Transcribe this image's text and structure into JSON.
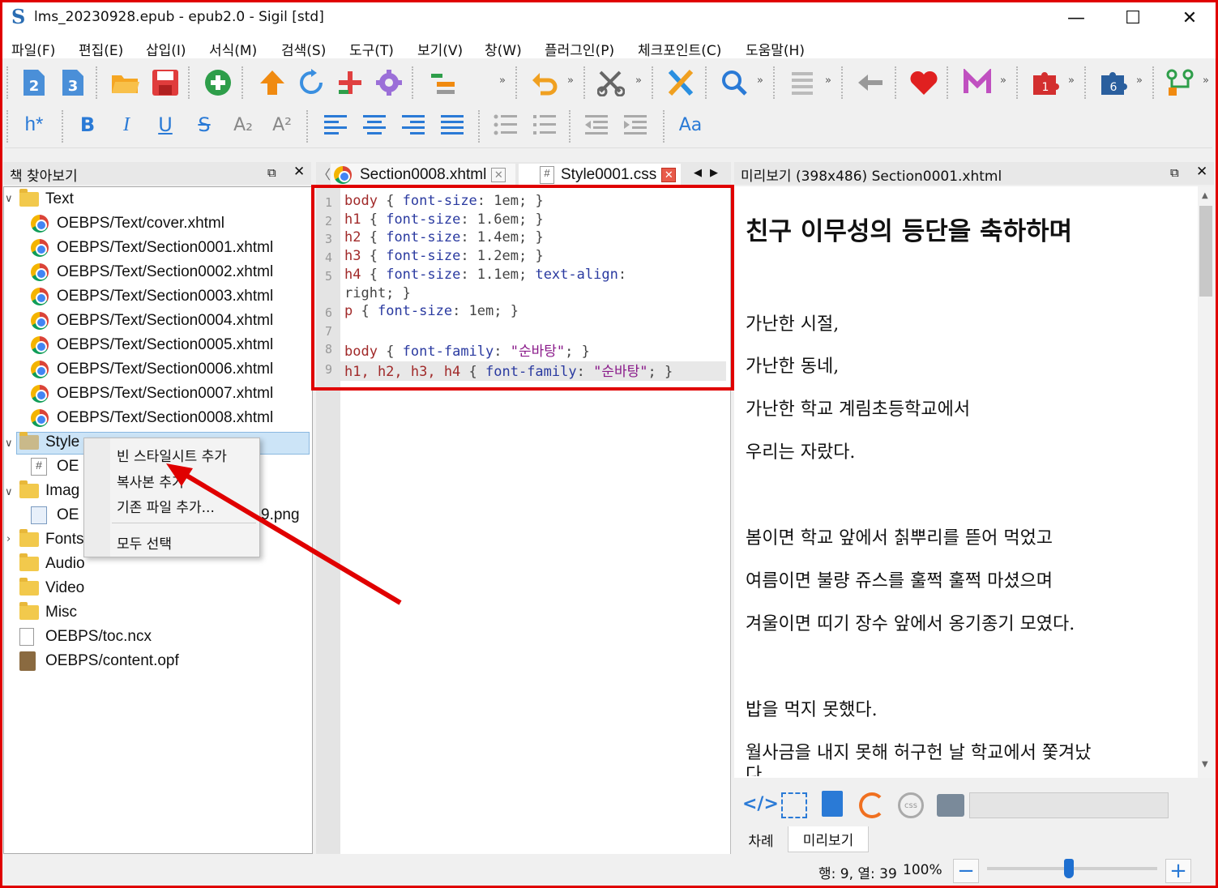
{
  "window": {
    "title": "lms_20230928.epub - epub2.0 - Sigil [std]",
    "logo_text": "S",
    "minimize": "—",
    "maximize": "☐",
    "close": "✕"
  },
  "menu": [
    "파일(F)",
    "편집(E)",
    "삽입(I)",
    "서식(M)",
    "검색(S)",
    "도구(T)",
    "보기(V)",
    "창(W)",
    "플러그인(P)",
    "체크포인트(C)",
    "도움말(H)"
  ],
  "toolbar1": {
    "icons": [
      "epub2-icon",
      "epub3-icon",
      "open-folder-icon",
      "save-icon",
      "add-icon",
      "up-arrow-icon",
      "refresh-icon",
      "add-existing-icon",
      "settings-icon",
      "insert-icon",
      "undo-icon",
      "cut-icon",
      "validate-icon",
      "search-icon",
      "list-icon",
      "back-icon",
      "heart-icon",
      "mail-icon",
      "plugin1-icon",
      "plugin6-icon",
      "plugin-branch-icon"
    ],
    "plugin_badges": [
      "1",
      "6"
    ],
    "epub_labels": [
      "2",
      "3"
    ]
  },
  "toolbar2": {
    "heading_label": "h*",
    "bold": "B",
    "italic": "I",
    "underline": "U",
    "strike": "S",
    "subscript": "A₂",
    "superscript": "A²",
    "case_label": "Aa"
  },
  "book_browser": {
    "title": "책 찾아보기",
    "rows": [
      {
        "label": "Text",
        "kind": "folder"
      },
      {
        "label": "OEBPS/Text/cover.xhtml",
        "kind": "chrome"
      },
      {
        "label": "OEBPS/Text/Section0001.xhtml",
        "kind": "chrome"
      },
      {
        "label": "OEBPS/Text/Section0002.xhtml",
        "kind": "chrome"
      },
      {
        "label": "OEBPS/Text/Section0003.xhtml",
        "kind": "chrome"
      },
      {
        "label": "OEBPS/Text/Section0004.xhtml",
        "kind": "chrome"
      },
      {
        "label": "OEBPS/Text/Section0005.xhtml",
        "kind": "chrome"
      },
      {
        "label": "OEBPS/Text/Section0006.xhtml",
        "kind": "chrome"
      },
      {
        "label": "OEBPS/Text/Section0007.xhtml",
        "kind": "chrome"
      },
      {
        "label": "OEBPS/Text/Section0008.xhtml",
        "kind": "chrome"
      },
      {
        "label": "Style",
        "kind": "folder-selected"
      },
      {
        "label": "OE",
        "kind": "css"
      },
      {
        "label": "Imag",
        "kind": "folder"
      },
      {
        "label": "OE",
        "kind": "image",
        "suffix": "9.png"
      },
      {
        "label": "Fonts",
        "kind": "folder"
      },
      {
        "label": "Audio",
        "kind": "folder"
      },
      {
        "label": "Video",
        "kind": "folder"
      },
      {
        "label": "Misc",
        "kind": "folder"
      },
      {
        "label": "OEBPS/toc.ncx",
        "kind": "file"
      },
      {
        "label": "OEBPS/content.opf",
        "kind": "opf"
      }
    ]
  },
  "context_menu": {
    "items": [
      "빈 스타일시트 추가",
      "복사본 추가",
      "기존 파일 추가...",
      "모두 선택"
    ]
  },
  "tabs": [
    {
      "label": "Section0008.xhtml",
      "icon": "chrome-icon",
      "close": "✕"
    },
    {
      "label": "Style0001.css",
      "icon": "hash-icon",
      "close": "✕"
    }
  ],
  "tab_nav": {
    "left": "◀",
    "right": "▶"
  },
  "editor": {
    "line_numbers": [
      "1",
      "2",
      "3",
      "4",
      "5",
      "",
      "6",
      "7",
      "8",
      "9"
    ],
    "lines": [
      [
        {
          "t": "body",
          "c": "kw"
        },
        {
          "t": " { ",
          "c": "val"
        },
        {
          "t": "font-size",
          "c": "prop"
        },
        {
          "t": ": 1em; }",
          "c": "val"
        }
      ],
      [
        {
          "t": "h1",
          "c": "kw"
        },
        {
          "t": " { ",
          "c": "val"
        },
        {
          "t": "font-size",
          "c": "prop"
        },
        {
          "t": ": 1.6em; }",
          "c": "val"
        }
      ],
      [
        {
          "t": "h2",
          "c": "kw"
        },
        {
          "t": " { ",
          "c": "val"
        },
        {
          "t": "font-size",
          "c": "prop"
        },
        {
          "t": ": 1.4em; }",
          "c": "val"
        }
      ],
      [
        {
          "t": "h3",
          "c": "kw"
        },
        {
          "t": " { ",
          "c": "val"
        },
        {
          "t": "font-size",
          "c": "prop"
        },
        {
          "t": ": 1.2em; }",
          "c": "val"
        }
      ],
      [
        {
          "t": "h4",
          "c": "kw"
        },
        {
          "t": " { ",
          "c": "val"
        },
        {
          "t": "font-size",
          "c": "prop"
        },
        {
          "t": ": 1.1em; ",
          "c": "val"
        },
        {
          "t": "text-align",
          "c": "prop"
        },
        {
          "t": ":",
          "c": "val"
        }
      ],
      [
        {
          "t": "right; }",
          "c": "val"
        }
      ],
      [
        {
          "t": "p",
          "c": "kw"
        },
        {
          "t": " { ",
          "c": "val"
        },
        {
          "t": "font-size",
          "c": "prop"
        },
        {
          "t": ": 1em; }",
          "c": "val"
        }
      ],
      [],
      [
        {
          "t": "body",
          "c": "kw"
        },
        {
          "t": " { ",
          "c": "val"
        },
        {
          "t": "font-family",
          "c": "prop"
        },
        {
          "t": ": ",
          "c": "val"
        },
        {
          "t": "\"순바탕\"",
          "c": "str"
        },
        {
          "t": "; }",
          "c": "val"
        }
      ],
      [
        {
          "t": "h1, h2, h3, h4",
          "c": "kw"
        },
        {
          "t": " { ",
          "c": "val"
        },
        {
          "t": "font-family",
          "c": "prop"
        },
        {
          "t": ": ",
          "c": "val"
        },
        {
          "t": "\"순바탕\"",
          "c": "str"
        },
        {
          "t": "; }",
          "c": "val"
        }
      ]
    ]
  },
  "preview": {
    "title": "미리보기 (398x486) Section0001.xhtml",
    "heading": "친구 이무성의 등단을 축하하며",
    "paragraphs": [
      "가난한 시절,",
      "가난한 동네,",
      "가난한 학교 계림초등학교에서",
      "우리는 자랐다.",
      "봄이면 학교 앞에서 칡뿌리를 뜯어 먹었고",
      "여름이면 불량 쥬스를 훌쩍 훌쩍 마셨으며",
      "겨울이면 띠기 장수 앞에서 옹기종기 모였다.",
      "밥을 먹지 못했다.",
      "월사금을 내지 못해 허구헌 날 학교에서 쫓겨났",
      "다"
    ],
    "tool_icons": [
      "code-view-icon",
      "toc-icon",
      "copy-icon",
      "reload-icon",
      "css-icon",
      "print-icon"
    ],
    "bottom_tabs": [
      "차례",
      "미리보기"
    ]
  },
  "status": {
    "position": "행: 9, 열: 39",
    "zoom": "100%",
    "zoom_out": "−",
    "zoom_in": "+",
    "zoom_level": 0.48
  },
  "colors": {
    "annotation_red": "#e00000",
    "accent_blue": "#1e6fd0"
  }
}
